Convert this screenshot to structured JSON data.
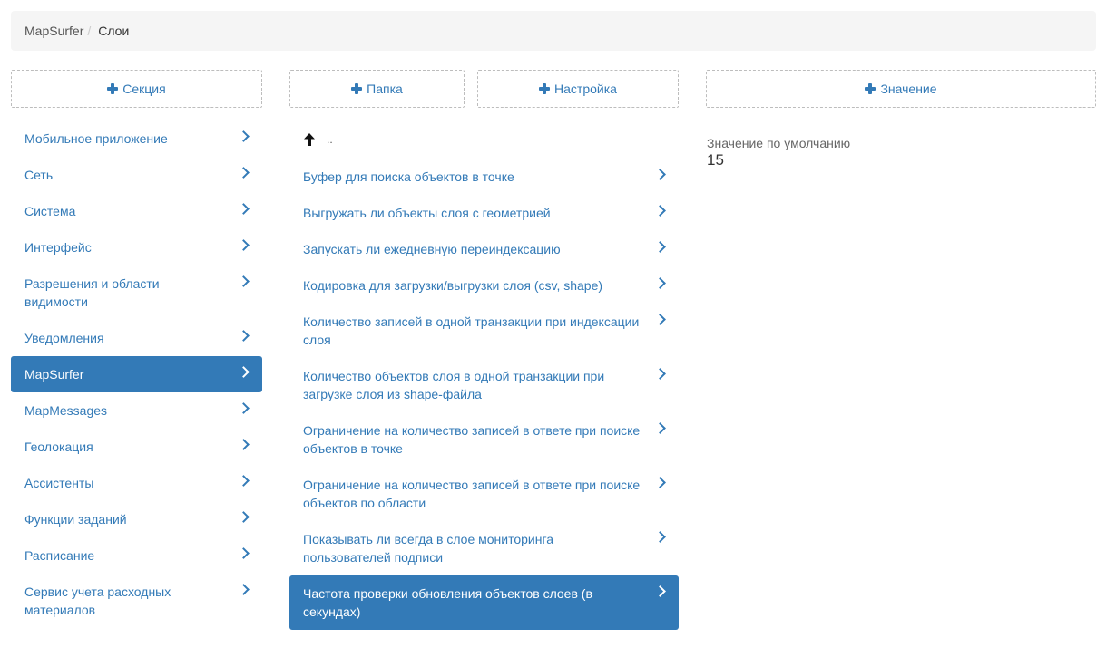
{
  "breadcrumb": {
    "root": "MapSurfer",
    "separator": "/",
    "current": "Слои"
  },
  "buttons": {
    "add_section": "Секция",
    "add_folder": "Папка",
    "add_setting": "Настройка",
    "add_value": "Значение"
  },
  "sections": [
    {
      "label": "Мобильное приложение",
      "active": false
    },
    {
      "label": "Сеть",
      "active": false
    },
    {
      "label": "Система",
      "active": false
    },
    {
      "label": "Интерфейс",
      "active": false
    },
    {
      "label": "Разрешения и области видимости",
      "active": false
    },
    {
      "label": "Уведомления",
      "active": false
    },
    {
      "label": "MapSurfer",
      "active": true
    },
    {
      "label": "MapMessages",
      "active": false
    },
    {
      "label": "Геолокация",
      "active": false
    },
    {
      "label": "Ассистенты",
      "active": false
    },
    {
      "label": "Функции заданий",
      "active": false
    },
    {
      "label": "Расписание",
      "active": false
    },
    {
      "label": "Сервис учета расходных материалов",
      "active": false
    }
  ],
  "settings": {
    "up_label": "..",
    "items": [
      {
        "label": "Буфер для поиска объектов в точке",
        "active": false
      },
      {
        "label": "Выгружать ли объекты слоя с геометрией",
        "active": false
      },
      {
        "label": "Запускать ли ежедневную переиндексацию",
        "active": false
      },
      {
        "label": "Кодировка для загрузки/выгрузки слоя (csv, shape)",
        "active": false
      },
      {
        "label": "Количество записей в одной транзакции при индексации слоя",
        "active": false
      },
      {
        "label": "Количество объектов слоя в одной транзакции при загрузке слоя из shape-файла",
        "active": false
      },
      {
        "label": "Ограничение на количество записей в ответе при поиске объектов в точке",
        "active": false
      },
      {
        "label": "Ограничение на количество записей в ответе при поиске объектов по области",
        "active": false
      },
      {
        "label": "Показывать ли всегда в слое мониторинга пользователей подписи",
        "active": false
      },
      {
        "label": "Частота проверки обновления объектов слоев (в секундах)",
        "active": true
      }
    ]
  },
  "value_panel": {
    "label": "Значение по умолчанию",
    "value": "15"
  },
  "colors": {
    "accent": "#337ab7",
    "breadcrumb_bg": "#f5f5f5",
    "dashed_border": "#bdbdbd"
  }
}
